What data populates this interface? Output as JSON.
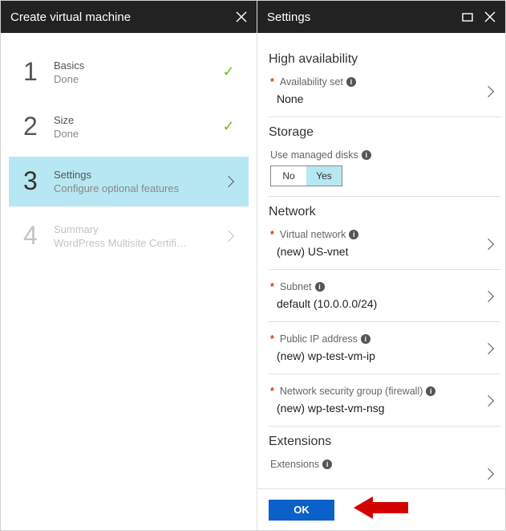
{
  "leftPanel": {
    "title": "Create virtual machine",
    "steps": [
      {
        "num": "1",
        "title": "Basics",
        "sub": "Done",
        "state": "done"
      },
      {
        "num": "2",
        "title": "Size",
        "sub": "Done",
        "state": "done"
      },
      {
        "num": "3",
        "title": "Settings",
        "sub": "Configure optional features",
        "state": "active"
      },
      {
        "num": "4",
        "title": "Summary",
        "sub": "WordPress Multisite Certified b...",
        "state": "disabled"
      }
    ]
  },
  "rightPanel": {
    "title": "Settings",
    "sections": {
      "highAvailability": {
        "heading": "High availability",
        "availabilitySet": {
          "label": "Availability set",
          "required": true,
          "value": "None"
        }
      },
      "storage": {
        "heading": "Storage",
        "managedDisks": {
          "label": "Use managed disks",
          "options": [
            "No",
            "Yes"
          ],
          "selected": "Yes"
        }
      },
      "network": {
        "heading": "Network",
        "virtualNetwork": {
          "label": "Virtual network",
          "required": true,
          "value": "(new) US-vnet"
        },
        "subnet": {
          "label": "Subnet",
          "required": true,
          "value": "default (10.0.0.0/24)"
        },
        "publicIp": {
          "label": "Public IP address",
          "required": true,
          "value": "(new) wp-test-vm-ip"
        },
        "nsg": {
          "label": "Network security group (firewall)",
          "required": true,
          "value": "(new) wp-test-vm-nsg"
        }
      },
      "extensions": {
        "heading": "Extensions",
        "extensions": {
          "label": "Extensions",
          "value": ""
        }
      }
    },
    "footer": {
      "ok": "OK"
    }
  }
}
